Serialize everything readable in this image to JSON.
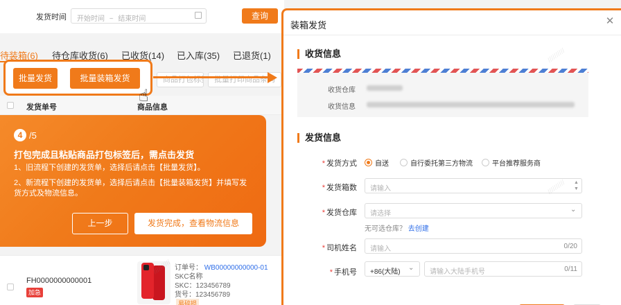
{
  "filter": {
    "ship_time_label": "发货时间",
    "date_start_placeholder": "开始时间",
    "date_sep": "~",
    "date_end_placeholder": "结束时间",
    "query_label": "查询"
  },
  "tabs": [
    {
      "label": "待装箱(6)",
      "active": true
    },
    {
      "label": "待仓库收货(6)"
    },
    {
      "label": "已收货(14)"
    },
    {
      "label": "已入库(35)"
    },
    {
      "label": "已退货(1)"
    }
  ],
  "toolbar": {
    "batch_ship": "批量发货",
    "batch_box_ship": "批量装箱发货",
    "ghost_1": "商品打包标签",
    "ghost_2": "批量打印商品条码"
  },
  "table": {
    "col_ship_no": "发货单号",
    "col_product": "商品信息",
    "rows": [
      {
        "ship_no": "FH0000000000001",
        "tag": "加急",
        "order_label": "订单号：",
        "order_no": "WB00000000000-01",
        "skc_name": "SKC名称",
        "skc": "SKC：123456789",
        "item_no": "货号：123456789",
        "fragile": "易碎损"
      }
    ]
  },
  "guide": {
    "step": "4",
    "total": "/5",
    "title": "打包完成且粘贴商品打包标签后，需点击发货",
    "line1": "1、旧流程下创建的发货单，选择后请点击【批量发货】。",
    "line2a": "2、新流程下创建的发货单，选择后请点击【批量装箱发货】并填写发",
    "line2b": "货方式及物流信息。",
    "prev": "上一步",
    "done": "发货完成，查看物流信息"
  },
  "modal": {
    "title": "装箱发货",
    "close_icon": "close-icon",
    "receive_section": "收货信息",
    "warehouse_label": "收货仓库",
    "address_label": "收货信息",
    "ship_section": "发货信息",
    "method_label": "发货方式",
    "method_options": [
      "自送",
      "自行委托第三方物流",
      "平台推荐服务商"
    ],
    "method_selected": "自送",
    "box_count_label": "发货箱数",
    "box_count_placeholder": "请输入",
    "warehouse_select_label": "发货仓库",
    "warehouse_select_placeholder": "请选择",
    "no_warehouse_hint": "无可选仓库？",
    "create_link": "去创建",
    "driver_label": "司机姓名",
    "driver_placeholder": "请输入",
    "driver_count": "0/20",
    "phone_label": "手机号",
    "phone_code": "+86(大陆)",
    "phone_placeholder": "请输入大陆手机号",
    "phone_count": "0/11"
  },
  "colors": {
    "accent": "#f07a1a",
    "link": "#2f6ee8",
    "danger": "#e8403a"
  }
}
